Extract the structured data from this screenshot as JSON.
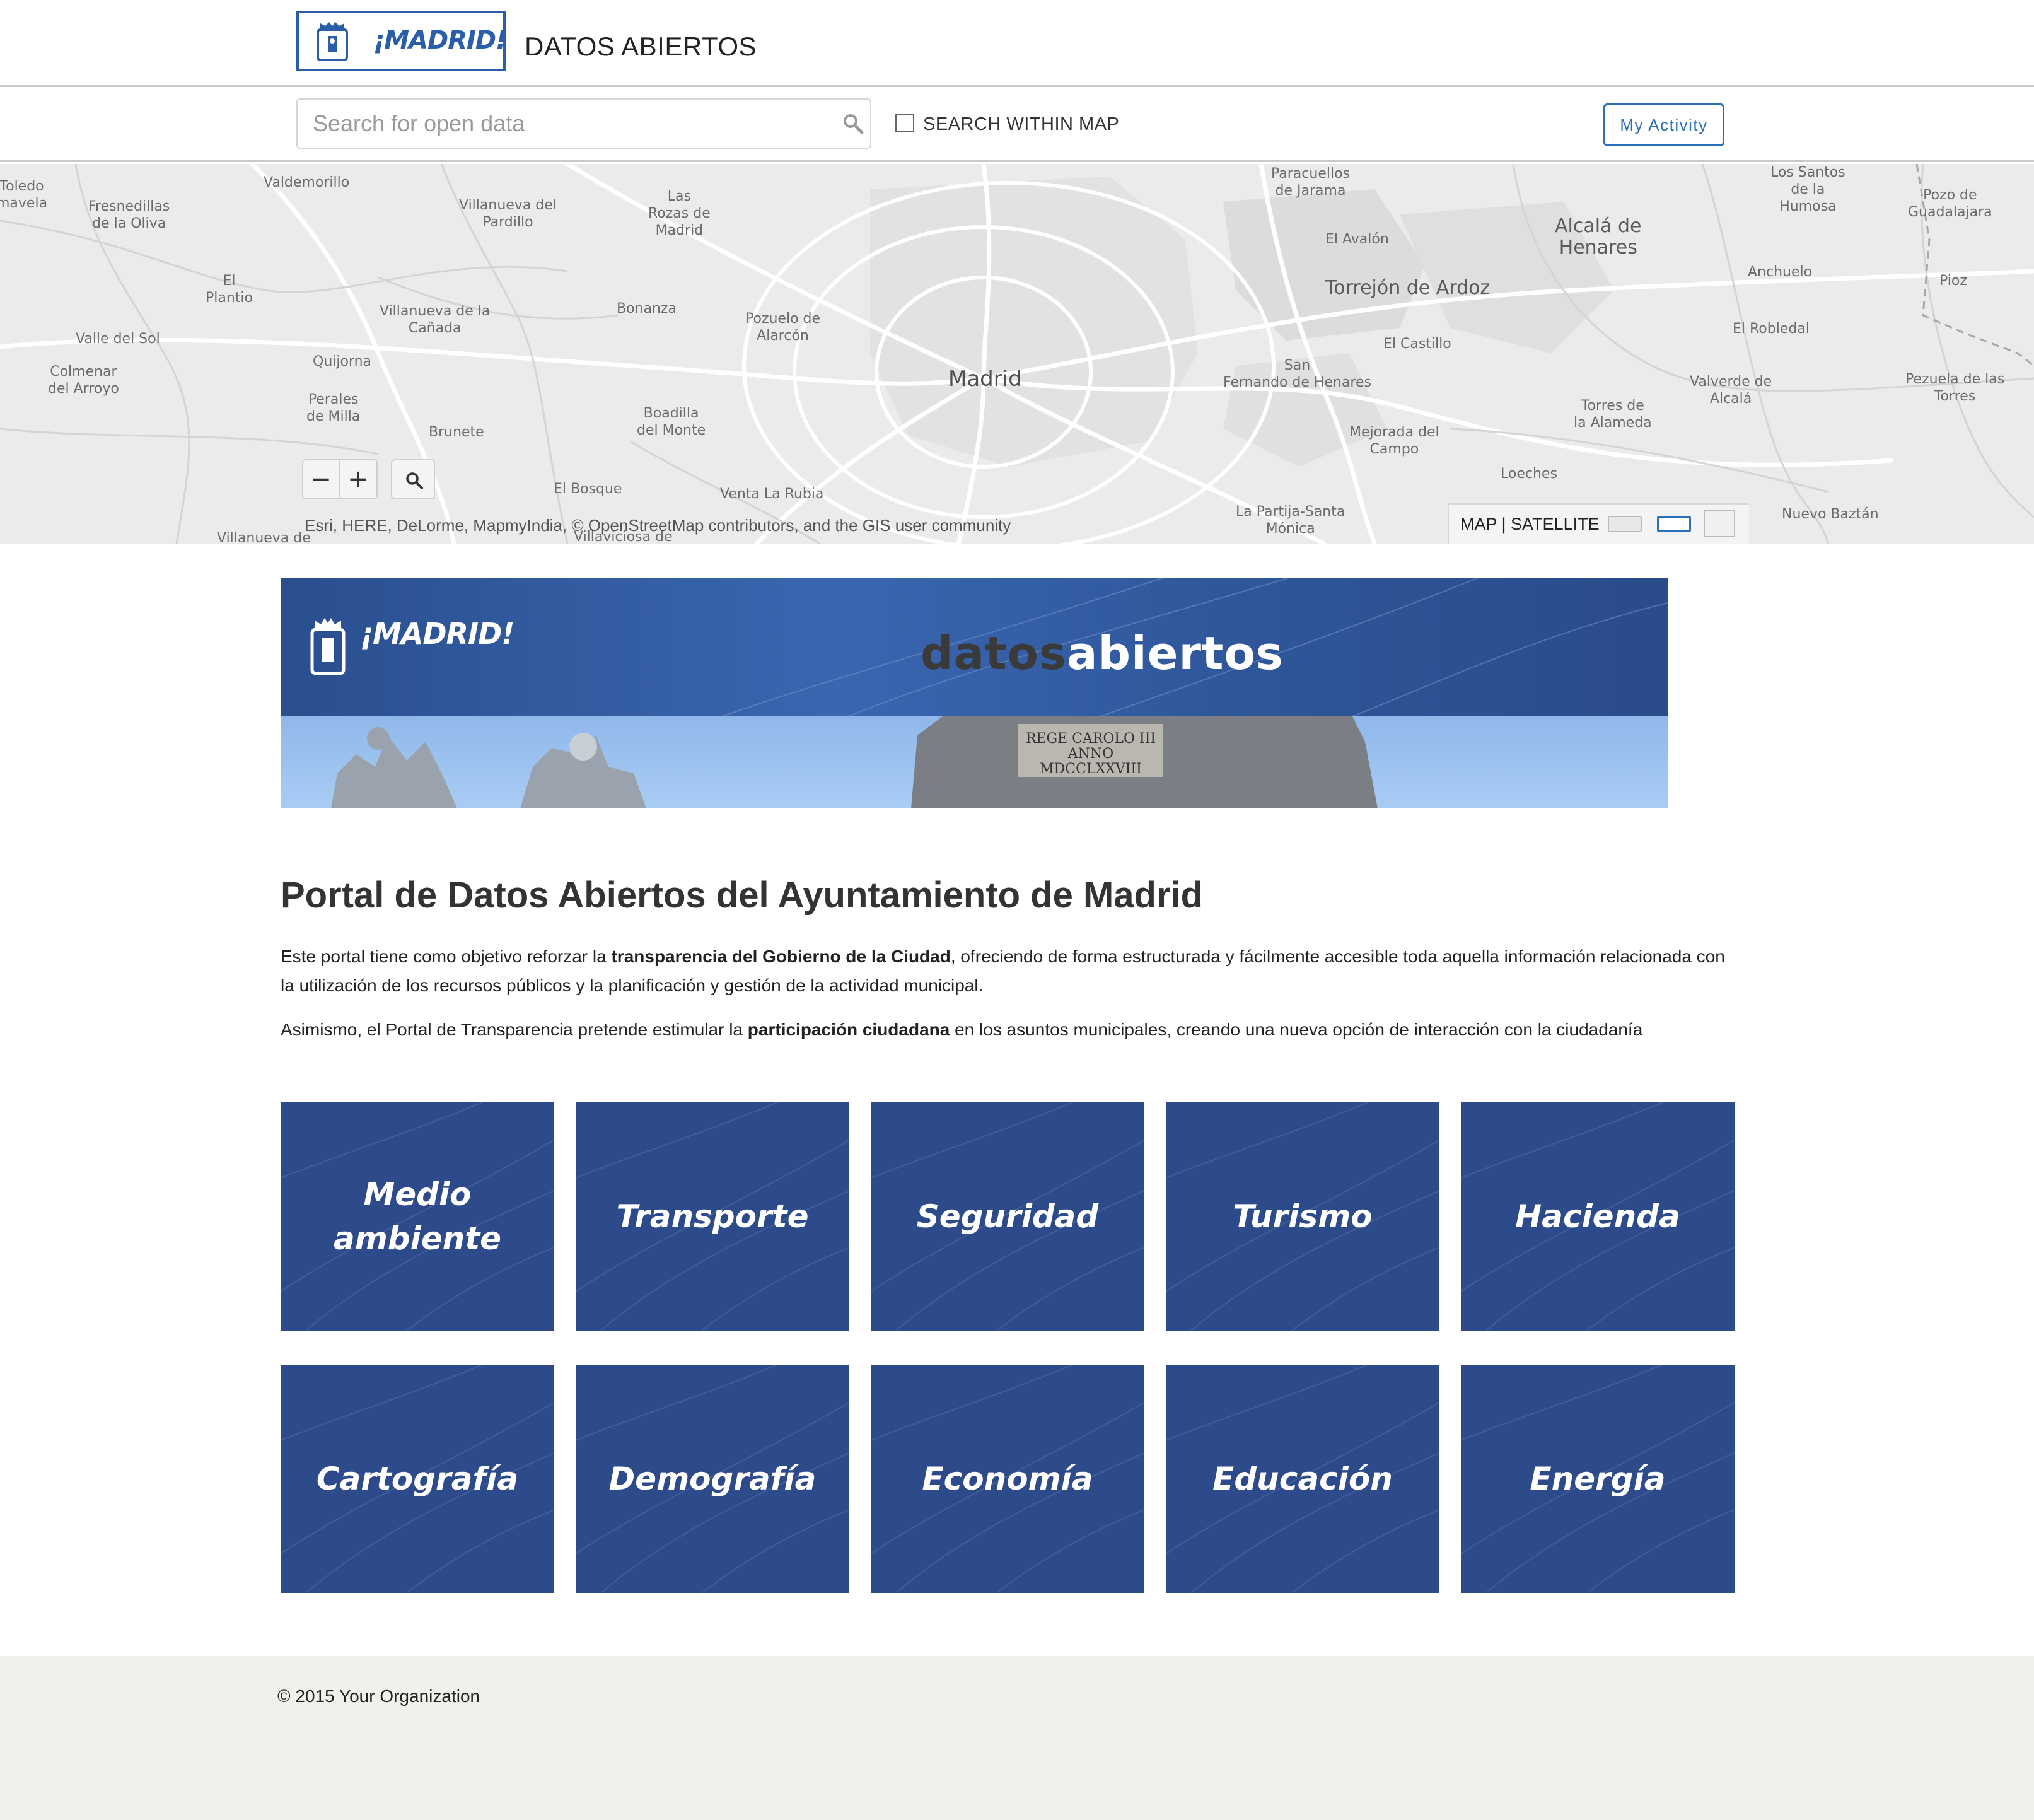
{
  "header": {
    "logo_text": "¡MADRID!",
    "title": "DATOS ABIERTOS"
  },
  "searchbar": {
    "placeholder": "Search for open data",
    "within_map_label": "SEARCH WITHIN MAP",
    "activity_label": "My Activity"
  },
  "map": {
    "places": [
      {
        "name": "Toledo\nmavela"
      },
      {
        "name": "Fresnedillas\nde la Oliva"
      },
      {
        "name": "Valdemorillo"
      },
      {
        "name": "Villanueva del\nPardillo"
      },
      {
        "name": "Las\nRozas de\nMadrid"
      },
      {
        "name": "Paracuellos\nde Jarama"
      },
      {
        "name": "Los Santos\nde la\nHumosa"
      },
      {
        "name": "Pozo de\nGuadalajara"
      },
      {
        "name": "El Avalón"
      },
      {
        "name": "Alcalá de\nHenares"
      },
      {
        "name": "Torrejón de Ardoz"
      },
      {
        "name": "Anchuelo"
      },
      {
        "name": "Pioz"
      },
      {
        "name": "El\nPlantio"
      },
      {
        "name": "Villanueva de la\nCañada"
      },
      {
        "name": "Bonanza"
      },
      {
        "name": "Pozuelo de\nAlarcón"
      },
      {
        "name": "El Robledal"
      },
      {
        "name": "Valle del Sol"
      },
      {
        "name": "Quijorna"
      },
      {
        "name": "Colmenar\ndel Arroyo"
      },
      {
        "name": "Madrid"
      },
      {
        "name": "El Castillo"
      },
      {
        "name": "San\nFernando de Henares"
      },
      {
        "name": "Valverde de\nAlcalá"
      },
      {
        "name": "Pezuela de las\nTorres"
      },
      {
        "name": "Perales\nde Milla"
      },
      {
        "name": "Brunete"
      },
      {
        "name": "Boadilla\ndel Monte"
      },
      {
        "name": "Torres de\nla Alameda"
      },
      {
        "name": "Mejorada del\nCampo"
      },
      {
        "name": "Loeches"
      },
      {
        "name": "El Bosque"
      },
      {
        "name": "Venta La Rubia"
      },
      {
        "name": "La Partija-Santa\nMónica"
      },
      {
        "name": "Nuevo Baztán"
      },
      {
        "name": "Villanueva de"
      },
      {
        "name": "Villaviciosa de"
      }
    ],
    "zoom_out": "−",
    "zoom_in": "+",
    "attribution": "Esri, HERE, DeLorme, MapmyIndia, © OpenStreetMap contributors, and the GIS user community",
    "basemap_label": "MAP | SATELLITE"
  },
  "banner": {
    "logo_text": "¡MADRID!",
    "title_part1": "datos",
    "title_part2": "abiertos"
  },
  "intro": {
    "title": "Portal de Datos Abiertos del Ayuntamiento de Madrid",
    "p1_a": "Este portal tiene como objetivo reforzar la ",
    "p1_b": "transparencia del Gobierno de la Ciudad",
    "p1_c": ", ofreciendo de forma estructurada y fácilmente accesible toda aquella información relacionada con la utilización de los recursos públicos y la planificación y gestión de la actividad municipal.",
    "p2_a": "Asimismo, el Portal de Transparencia pretende estimular la ",
    "p2_b": "participación ciudadana",
    "p2_c": " en los asuntos municipales, creando una nueva opción de interacción con la ciudadanía"
  },
  "categories": [
    {
      "label": "Medio ambiente"
    },
    {
      "label": "Transporte"
    },
    {
      "label": "Seguridad"
    },
    {
      "label": "Turismo"
    },
    {
      "label": "Hacienda"
    },
    {
      "label": "Cartografía"
    },
    {
      "label": "Demografía"
    },
    {
      "label": "Economía"
    },
    {
      "label": "Educación"
    },
    {
      "label": "Energía"
    }
  ],
  "footer": {
    "copyright": "© 2015 Your Organization"
  },
  "colors": {
    "brand_blue": "#2a5ea8",
    "tile_blue": "#2d4a8a",
    "footer_bg": "#f0f0ec"
  }
}
